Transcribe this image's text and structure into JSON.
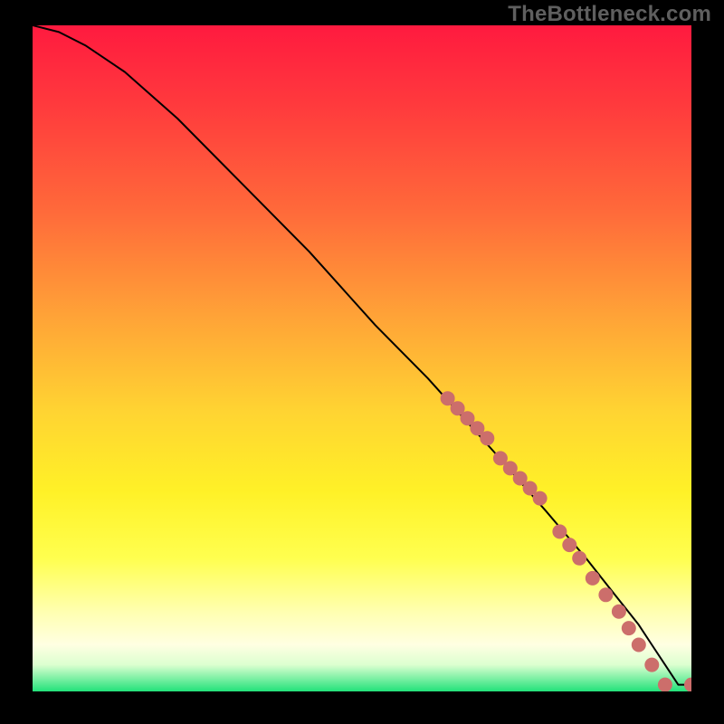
{
  "watermark": "TheBottleneck.com",
  "chart_data": {
    "type": "line",
    "title": "",
    "xlabel": "",
    "ylabel": "",
    "xlim": [
      0,
      100
    ],
    "ylim": [
      0,
      100
    ],
    "curve": {
      "name": "bottleneck-curve",
      "x": [
        0,
        4,
        8,
        14,
        22,
        32,
        42,
        52,
        60,
        70,
        78,
        84,
        88,
        92,
        94,
        96,
        98,
        100
      ],
      "y": [
        100,
        99,
        97,
        93,
        86,
        76,
        66,
        55,
        47,
        36,
        27,
        20,
        15,
        10,
        7,
        4,
        1,
        1
      ]
    },
    "markers": {
      "name": "highlighted-points",
      "points": [
        {
          "x": 63,
          "y": 44
        },
        {
          "x": 64.5,
          "y": 42.5
        },
        {
          "x": 66,
          "y": 41
        },
        {
          "x": 67.5,
          "y": 39.5
        },
        {
          "x": 69,
          "y": 38
        },
        {
          "x": 71,
          "y": 35
        },
        {
          "x": 72.5,
          "y": 33.5
        },
        {
          "x": 74,
          "y": 32
        },
        {
          "x": 75.5,
          "y": 30.5
        },
        {
          "x": 77,
          "y": 29
        },
        {
          "x": 80,
          "y": 24
        },
        {
          "x": 81.5,
          "y": 22
        },
        {
          "x": 83,
          "y": 20
        },
        {
          "x": 85,
          "y": 17
        },
        {
          "x": 87,
          "y": 14.5
        },
        {
          "x": 89,
          "y": 12
        },
        {
          "x": 90.5,
          "y": 9.5
        },
        {
          "x": 92,
          "y": 7
        },
        {
          "x": 94,
          "y": 4
        },
        {
          "x": 96,
          "y": 1
        },
        {
          "x": 100,
          "y": 1
        }
      ]
    },
    "background_gradient": {
      "stops": [
        {
          "pos": 0.0,
          "color": "#ff1a3f"
        },
        {
          "pos": 0.28,
          "color": "#ff6a3a"
        },
        {
          "pos": 0.58,
          "color": "#ffd432"
        },
        {
          "pos": 0.8,
          "color": "#ffff4f"
        },
        {
          "pos": 0.93,
          "color": "#ffffe2"
        },
        {
          "pos": 1.0,
          "color": "#22e27a"
        }
      ]
    }
  }
}
